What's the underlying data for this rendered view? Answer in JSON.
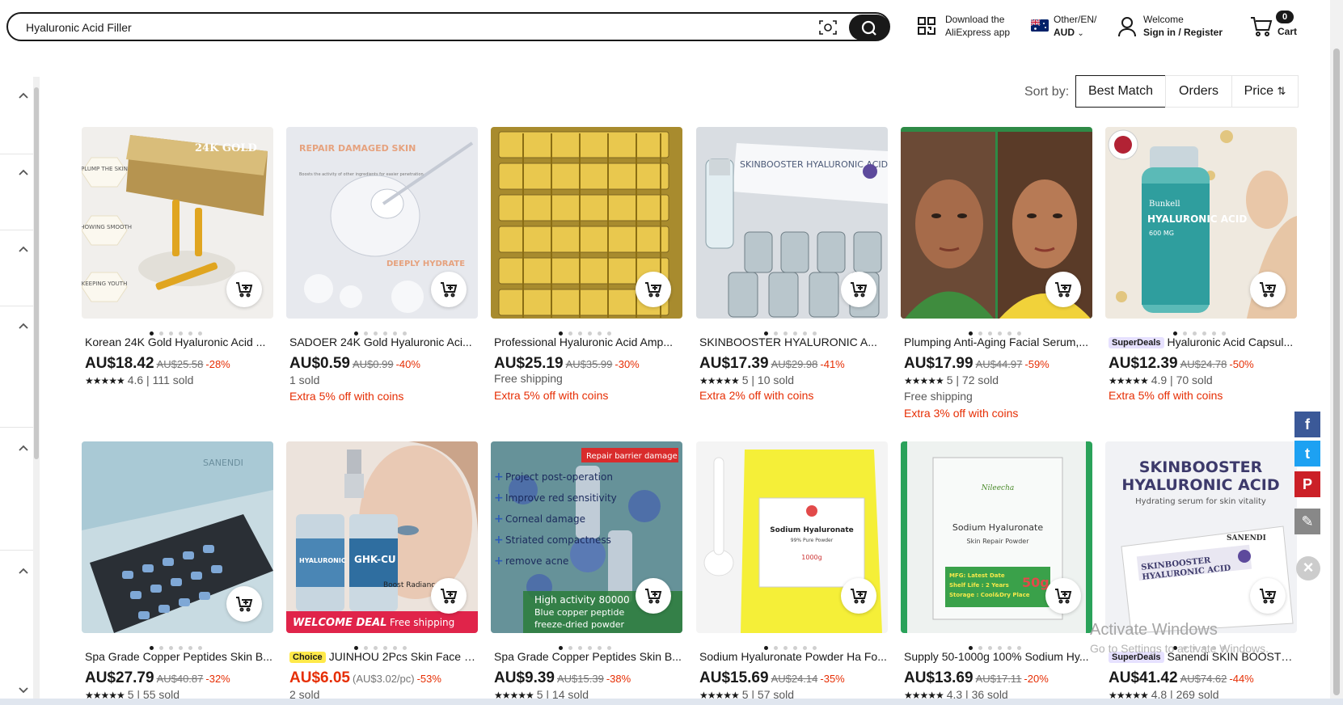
{
  "search": {
    "value": "Hyaluronic Acid Filler"
  },
  "header": {
    "app_line1": "Download the",
    "app_line2": "AliExpress app",
    "locale_line1": "Other/EN/",
    "locale_line2": "AUD",
    "account_line1": "Welcome",
    "account_line2": "Sign in / Register",
    "cart_count": "0",
    "cart_label": "Cart"
  },
  "sort": {
    "label": "Sort by:",
    "best_match": "Best Match",
    "orders": "Orders",
    "price": "Price"
  },
  "products": [
    {
      "title": "Korean 24K Gold Hyaluronic Acid ...",
      "price": "AU$18.42",
      "old": "AU$25.58",
      "disc": "-28%",
      "rating": "4.6",
      "sold": "111 sold",
      "l1": "",
      "l2": "",
      "promo": ""
    },
    {
      "title": "SADOER 24K Gold Hyaluronic Aci...",
      "price": "AU$0.59",
      "old": "AU$0.99",
      "disc": "-40%",
      "rating": "",
      "sold": "1 sold",
      "l1": "",
      "l2": "",
      "promo": "Extra 5% off with coins"
    },
    {
      "title": "Professional Hyaluronic Acid Amp...",
      "price": "AU$25.19",
      "old": "AU$35.99",
      "disc": "-30%",
      "rating": "",
      "sold": "",
      "l1": "Free shipping",
      "l2": "",
      "promo": "Extra 5% off with coins"
    },
    {
      "title": "SKINBOOSTER HYALURONIC A...",
      "price": "AU$17.39",
      "old": "AU$29.98",
      "disc": "-41%",
      "rating": "5",
      "sold": "10 sold",
      "l1": "",
      "l2": "",
      "promo": "Extra 2% off with coins"
    },
    {
      "title": "Plumping Anti-Aging Facial Serum,...",
      "price": "AU$17.99",
      "old": "AU$44.97",
      "disc": "-59%",
      "rating": "5",
      "sold": "72 sold",
      "l1": "Free shipping",
      "l2": "",
      "promo": "Extra 3% off with coins"
    },
    {
      "badge": "SuperDeals",
      "title": "Hyaluronic Acid Capsul...",
      "price": "AU$12.39",
      "old": "AU$24.78",
      "disc": "-50%",
      "rating": "4.9",
      "sold": "70 sold",
      "l1": "",
      "l2": "",
      "promo": "Extra 5% off with coins"
    },
    {
      "title": "Spa Grade Copper Peptides Skin B...",
      "price": "AU$27.79",
      "old": "AU$40.87",
      "disc": "-32%",
      "rating": "5",
      "sold": "55 sold",
      "promo": ""
    },
    {
      "badge": "Choice",
      "title": "JUINHOU 2Pcs Skin Face S...",
      "price": "AU$6.05",
      "unit": "(AU$3.02/pc)",
      "old": "",
      "disc": "-53%",
      "rating": "",
      "sold": "2 sold",
      "promo": ""
    },
    {
      "title": "Spa Grade Copper Peptides Skin B...",
      "price": "AU$9.39",
      "old": "AU$15.39",
      "disc": "-38%",
      "rating": "5",
      "sold": "14 sold",
      "promo": ""
    },
    {
      "title": "Sodium Hyaluronate Powder Ha Fo...",
      "price": "AU$15.69",
      "old": "AU$24.14",
      "disc": "-35%",
      "rating": "5",
      "sold": "57 sold",
      "promo": ""
    },
    {
      "title": "Supply 50-1000g 100% Sodium Hy...",
      "price": "AU$13.69",
      "old": "AU$17.11",
      "disc": "-20%",
      "rating": "4.3",
      "sold": "36 sold",
      "promo": ""
    },
    {
      "badge": "SuperDeals",
      "title": "Sanendi SKIN BOOSTE...",
      "price": "AU$41.42",
      "old": "AU$74.62",
      "disc": "-44%",
      "rating": "4.8",
      "sold": "269 sold",
      "promo": ""
    }
  ],
  "image_text": {
    "p1_box": "24K GOLD",
    "p1_plump": "PLUMP THE SKIN",
    "p1_smooth": "SHOWING SMOOTH",
    "p1_youth": "KEEPING YOUTH",
    "p2_head": "REPAIR DAMAGED SKIN",
    "p2_sub": "Boosts the activity of other ingredients for easier penetration",
    "p2_deep": "DEEPLY HYDRATE",
    "p4_label": "SKINBOOSTER HYALURONIC ACID",
    "p6_brand": "Bunkell",
    "p6_name": "HYALURONIC ACID",
    "p6_mg": "600 MG",
    "p7_label": "SANENDI",
    "p8_serum1": "HYALURONIC",
    "p8_serum2": "GHK-CU",
    "p8_deal": "WELCOME DEAL",
    "p8_ship": "Free shipping",
    "p8_boost": "Boost Radiance",
    "p9_tag": "Repair barrier damage",
    "p9_items": [
      "Project post-operation",
      "Improve red sensitivity",
      "Corneal damage",
      "Striated compactness",
      "remove acne"
    ],
    "p9_bottom1": "High activity 80000",
    "p9_bottom2": "Blue copper peptide",
    "p9_bottom3": "freeze-dried powder",
    "p10_name": "Sodium Hyaluronate",
    "p10_pure": "99% Pure Powder",
    "p10_wt": "1000g",
    "p11_brand": "Nileecha",
    "p11_name": "Sodium Hyaluronate",
    "p11_sub": "Skin Repair Powder",
    "p11_wt": "50g",
    "p11_mfg": "MFG: Latest Date",
    "p11_shelf": "Shelf Life : 2 Years",
    "p11_store": "Storage : Cool&Dry Place",
    "p12_head1": "SKINBOOSTER",
    "p12_head2": "HYALURONIC ACID",
    "p12_sub": "Hydrating serum for skin vitality",
    "p12_brand": "SANENDI",
    "p12_box1": "SKINBOOSTER",
    "p12_box2": "HYALURONIC ACID"
  },
  "share": {
    "facebook": "f",
    "twitter": "t",
    "pinterest": "P",
    "edit": "✎",
    "close": "×"
  },
  "watermark": {
    "line1": "Activate Windows",
    "line2": "Go to Settings to activate Windows."
  }
}
